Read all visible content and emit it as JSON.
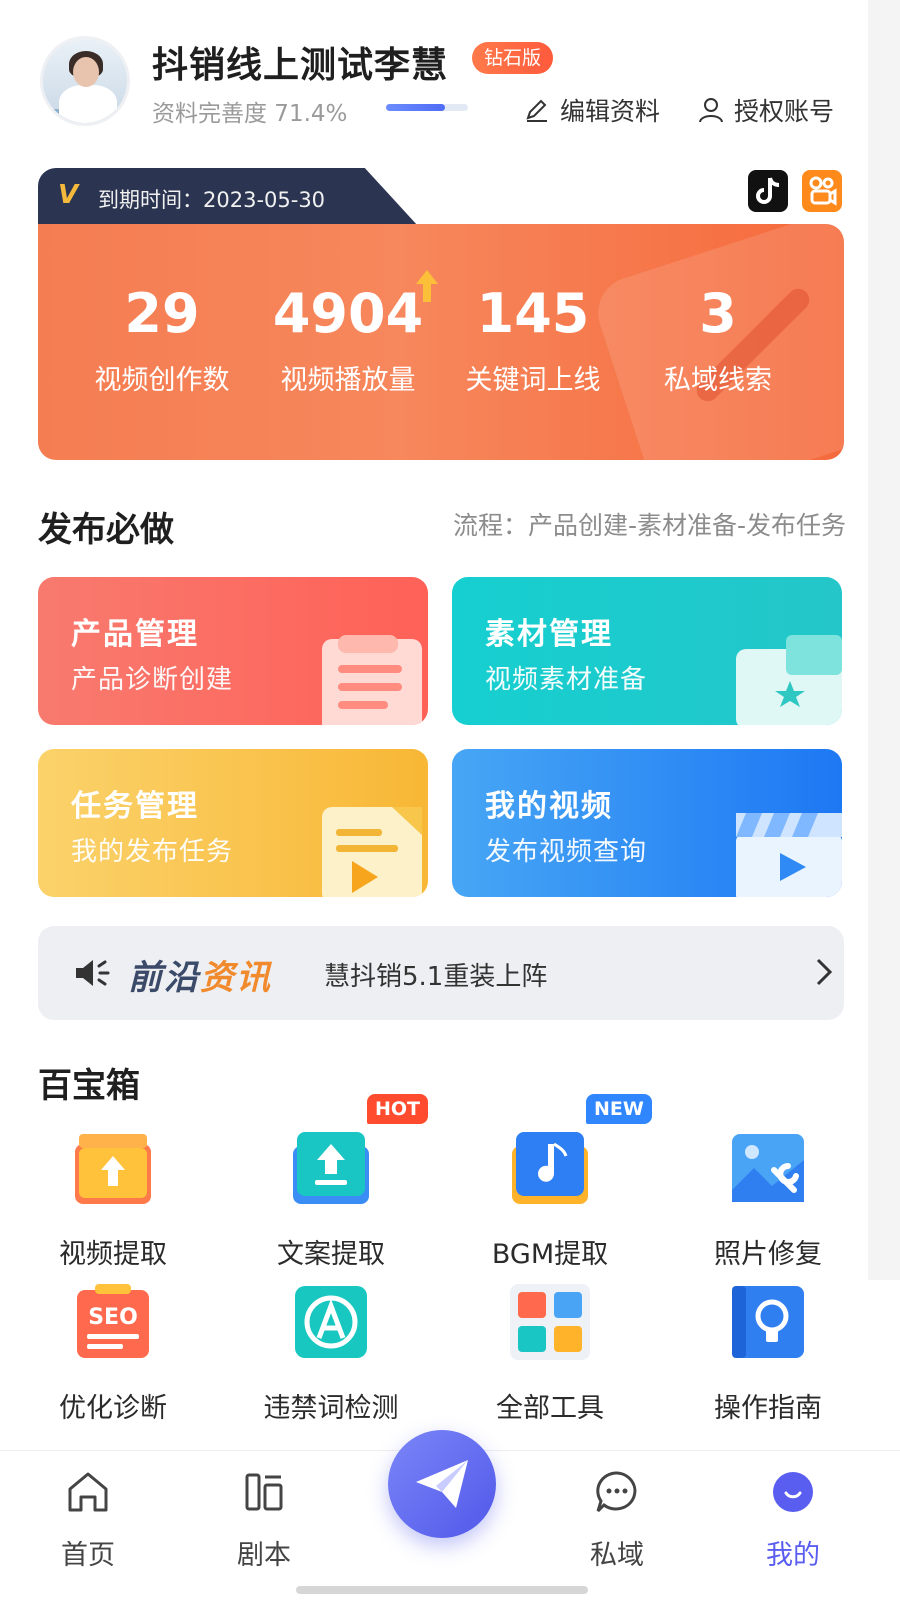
{
  "header": {
    "user_name": "抖销线上测试李慧",
    "tier_badge": "钻石版",
    "profile_completeness_label": "资料完善度 71.4%",
    "profile_completeness": 0.714,
    "edit_profile": "编辑资料",
    "authorize_account": "授权账号"
  },
  "stats_card": {
    "expiry": "到期时间：2023-05-30",
    "stats": [
      {
        "value": "29",
        "label": "视频创作数"
      },
      {
        "value": "4904",
        "label": "视频播放量"
      },
      {
        "value": "145",
        "label": "关键词上线"
      },
      {
        "value": "3",
        "label": "私域线索"
      }
    ],
    "platforms": [
      "tiktok-icon",
      "kuaishou-icon"
    ]
  },
  "publish": {
    "title": "发布必做",
    "flow_hint": "流程：产品创建-素材准备-发布任务",
    "cards": [
      {
        "title": "产品管理",
        "sub": "产品诊断创建"
      },
      {
        "title": "素材管理",
        "sub": "视频素材准备"
      },
      {
        "title": "任务管理",
        "sub": "我的发布任务"
      },
      {
        "title": "我的视频",
        "sub": "发布视频查询"
      }
    ]
  },
  "news": {
    "brand_dark": "前沿",
    "brand_accent": "资讯",
    "text": "慧抖销5.1重装上阵"
  },
  "toolbox": {
    "title": "百宝箱",
    "tools": [
      {
        "label": "视频提取",
        "icon": "video-extract-icon"
      },
      {
        "label": "文案提取",
        "icon": "copy-extract-icon",
        "badge": "HOT"
      },
      {
        "label": "BGM提取",
        "icon": "bgm-extract-icon",
        "badge": "NEW"
      },
      {
        "label": "照片修复",
        "icon": "photo-repair-icon"
      },
      {
        "label": "优化诊断",
        "icon": "seo-icon"
      },
      {
        "label": "违禁词检测",
        "icon": "banned-word-icon"
      },
      {
        "label": "全部工具",
        "icon": "all-tools-icon"
      },
      {
        "label": "操作指南",
        "icon": "guide-icon"
      }
    ]
  },
  "nav": {
    "items": [
      {
        "label": "首页",
        "icon": "home-icon"
      },
      {
        "label": "剧本",
        "icon": "script-icon"
      },
      {
        "label": "私域",
        "icon": "chat-icon"
      },
      {
        "label": "我的",
        "icon": "profile-icon",
        "active": true
      }
    ]
  },
  "colors": {
    "accent": "#5a5ef0",
    "stats_orange": "#f57d52",
    "badge_hot": "#ff4c2e",
    "badge_new": "#2f86ff"
  }
}
